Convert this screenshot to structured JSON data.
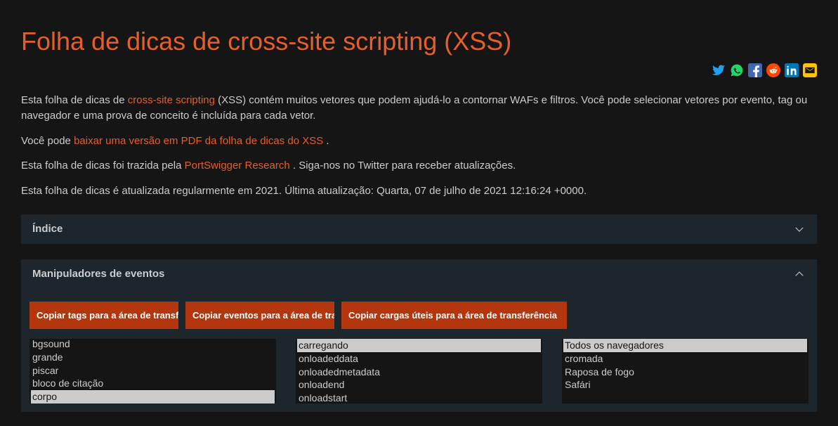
{
  "title": "Folha de dicas de cross-site scripting (XSS)",
  "share": {
    "twitter": "twitter-icon",
    "whatsapp": "whatsapp-icon",
    "facebook": "facebook-icon",
    "reddit": "reddit-icon",
    "linkedin": "linkedin-icon",
    "email": "email-icon"
  },
  "intro": {
    "p1_pre": "Esta folha de dicas de ",
    "p1_link": "cross-site scripting",
    "p1_post": " (XSS) contém muitos vetores que podem ajudá-lo a contornar WAFs e filtros. Você pode selecionar vetores por evento, tag ou navegador e uma prova de conceito é incluída para cada vetor.",
    "p2_pre": "Você pode ",
    "p2_link": "baixar uma versão em PDF da folha de dicas do XSS",
    "p2_post": " .",
    "p3_pre": "Esta folha de dicas foi trazida pela ",
    "p3_link": "PortSwigger Research",
    "p3_post": " . Siga-nos no Twitter para receber atualizações.",
    "p4": "Esta folha de dicas é atualizada regularmente em 2021. Última atualização: Quarta, 07 de julho de 2021 12:16:24 +0000."
  },
  "index": {
    "title": "Índice"
  },
  "handlers": {
    "title": "Manipuladores de eventos",
    "buttons": {
      "copy_tags": "Copiar tags para a área de transferência",
      "copy_events": "Copiar eventos para a área de transferência",
      "copy_payloads": "Copiar cargas úteis para a área de transferência"
    },
    "tags": {
      "items": [
        "bgsound",
        "grande",
        "piscar",
        "bloco de citação",
        "corpo"
      ],
      "selected": "corpo"
    },
    "events": {
      "items": [
        "carregando",
        "onloadeddata",
        "onloadedmetadata",
        "onloadend",
        "onloadstart"
      ],
      "selected": "carregando"
    },
    "browsers": {
      "items": [
        "Todos os navegadores",
        "cromada",
        "Raposa de fogo",
        "Safári"
      ],
      "selected": "Todos os navegadores"
    }
  }
}
